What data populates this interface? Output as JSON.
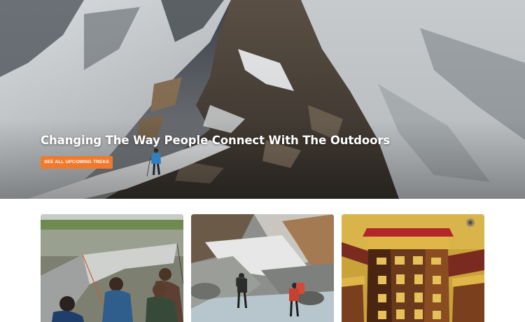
{
  "hero": {
    "title": "Changing The Way People Connect With The Outdoors",
    "cta_label": "SEE ALL UPCOMING TREKS"
  },
  "colors": {
    "accent": "#ef7a2e",
    "hero_text": "#ffffff",
    "background": "#ffffff"
  },
  "cards": [
    {
      "image": "camping-tent-group-photo"
    },
    {
      "image": "trekkers-crossing-rocky-stream-photo"
    },
    {
      "image": "golden-prayer-wheels-photo"
    }
  ]
}
